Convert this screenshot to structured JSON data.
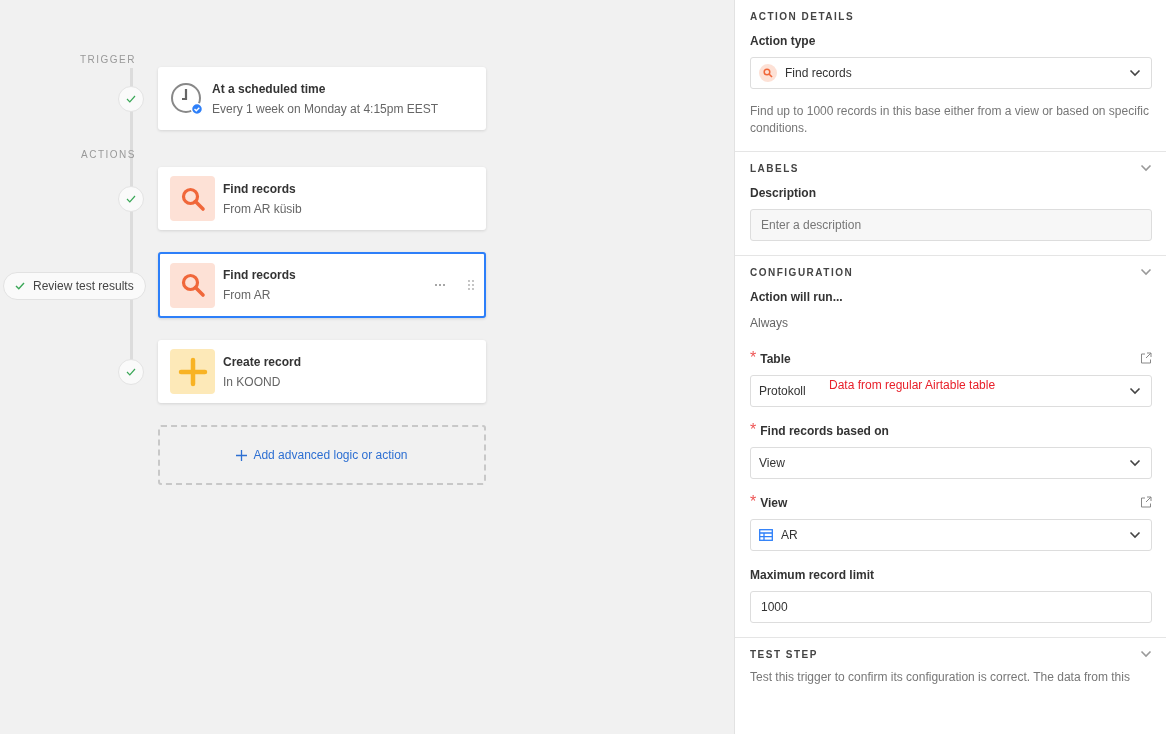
{
  "flow": {
    "sections": [
      {
        "label": "TRIGGER",
        "steps": [
          {
            "kind": "schedule",
            "title": "At a scheduled time",
            "subtitle": "Every 1 week on Monday at 4:15pm EEST",
            "selected": false,
            "tested": true
          }
        ]
      },
      {
        "label": "ACTIONS",
        "steps": [
          {
            "kind": "find",
            "title": "Find records",
            "subtitle": "From AR küsib",
            "selected": false,
            "tested": true
          },
          {
            "kind": "find",
            "title": "Find records",
            "subtitle": "From AR",
            "selected": true,
            "badge": "Review test results"
          },
          {
            "kind": "create",
            "title": "Create record",
            "subtitle": "In KOOND",
            "selected": false,
            "tested": true
          }
        ]
      }
    ],
    "add_button": "Add advanced logic or action"
  },
  "panel": {
    "sections": [
      {
        "title": "ACTION DETAILS",
        "collapsible": false,
        "fields": [
          {
            "kind": "actiontype",
            "label": "Action type",
            "value": "Find records"
          },
          {
            "kind": "help",
            "text": "Find up to 1000 records in this base either from a view or based on specific conditions."
          }
        ]
      },
      {
        "title": "LABELS",
        "collapsible": true,
        "fields": [
          {
            "kind": "input",
            "label": "Description",
            "placeholder": "Enter a description"
          }
        ]
      },
      {
        "title": "CONFIGURATION",
        "collapsible": true,
        "fields": [
          {
            "kind": "static",
            "label": "Action will run...",
            "value": "Always"
          },
          {
            "kind": "select",
            "required_mark": "*",
            "label": "Table",
            "external_link": true,
            "value": "Protokoll",
            "annotation": "Data from regular Airtable table"
          },
          {
            "kind": "select",
            "required_mark": "*",
            "label": "Find records based on",
            "external_link": false,
            "value": "View"
          },
          {
            "kind": "viewselect",
            "required_mark": "*",
            "label": "View",
            "external_link": true,
            "value": "AR"
          },
          {
            "kind": "input",
            "label": "Maximum record limit",
            "value": "1000"
          }
        ]
      },
      {
        "title": "TEST STEP",
        "collapsible": true,
        "fields": [
          {
            "kind": "help",
            "text": "Test this trigger to confirm its configuration is correct. The data from this"
          }
        ]
      }
    ]
  }
}
